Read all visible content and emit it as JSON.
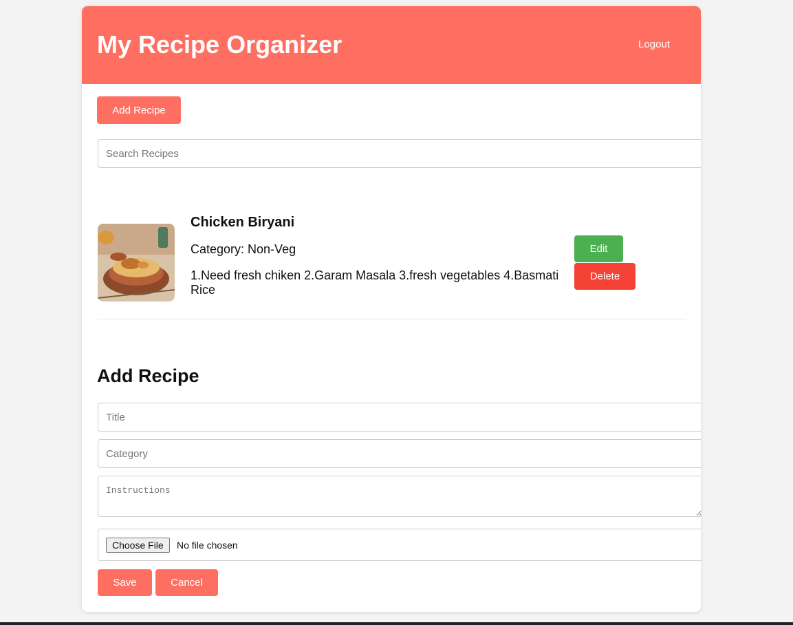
{
  "header": {
    "title": "My Recipe Organizer",
    "logout_label": "Logout"
  },
  "toolbar": {
    "add_recipe_label": "Add Recipe"
  },
  "search": {
    "placeholder": "Search Recipes"
  },
  "recipes": [
    {
      "title": "Chicken Biryani",
      "category": "Category: Non-Veg",
      "instructions": "1.Need fresh chiken 2.Garam Masala 3.fresh vegetables 4.Basmati Rice",
      "image_icon": "recipe-photo",
      "edit_label": "Edit",
      "delete_label": "Delete"
    }
  ],
  "form": {
    "heading": "Add Recipe",
    "title_placeholder": "Title",
    "category_placeholder": "Category",
    "instructions_placeholder": "Instructions",
    "choose_file_label": "Choose File",
    "file_status": "No file chosen",
    "save_label": "Save",
    "cancel_label": "Cancel"
  },
  "colors": {
    "accent": "#ff6f61",
    "edit": "#4caf50",
    "delete": "#f44336"
  }
}
